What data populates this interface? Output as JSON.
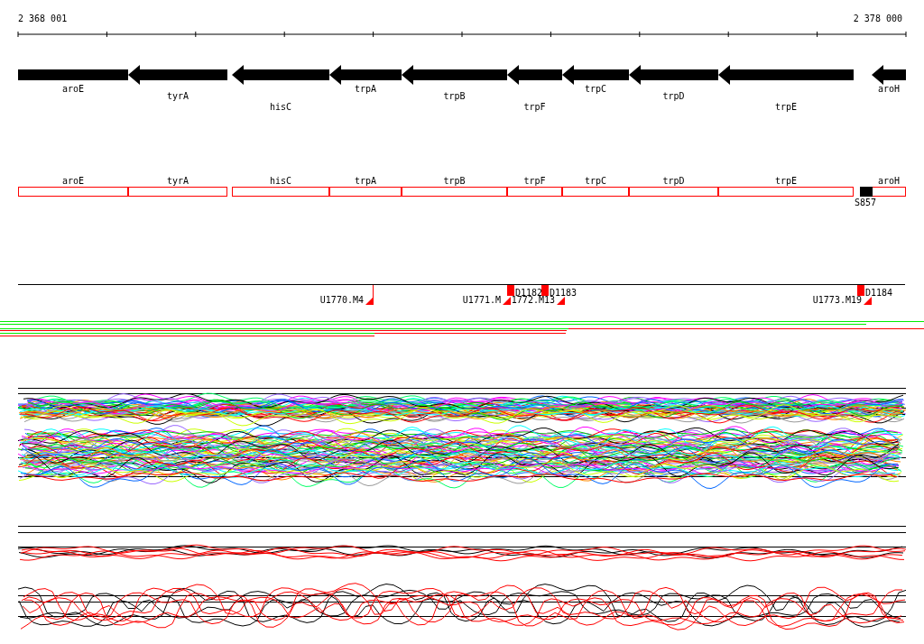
{
  "ruler": {
    "start": "2 368 001",
    "end": "2 378 000"
  },
  "genes": [
    {
      "name": "aroE",
      "kind": "block"
    },
    {
      "name": "tyrA",
      "kind": "reverse"
    },
    {
      "name": "hisC",
      "kind": "reverse"
    },
    {
      "name": "trpA",
      "kind": "reverse"
    },
    {
      "name": "trpB",
      "kind": "reverse"
    },
    {
      "name": "trpF",
      "kind": "reverse"
    },
    {
      "name": "trpC",
      "kind": "reverse"
    },
    {
      "name": "trpD",
      "kind": "reverse"
    },
    {
      "name": "trpE",
      "kind": "reverse"
    },
    {
      "name": "aroH",
      "kind": "reverse"
    }
  ],
  "gene_boxes": [
    {
      "name": "aroE"
    },
    {
      "name": "tyrA"
    },
    {
      "name": "hisC"
    },
    {
      "name": "trpA"
    },
    {
      "name": "trpB"
    },
    {
      "name": "trpF"
    },
    {
      "name": "trpC"
    },
    {
      "name": "trpD"
    },
    {
      "name": "trpE"
    },
    {
      "name": "aroH"
    }
  ],
  "feature": {
    "label": "S857"
  },
  "markers": [
    {
      "label": "U1770.M4",
      "kind": "u"
    },
    {
      "label": "U1771.M",
      "kind": "u"
    },
    {
      "label": "D1182",
      "kind": "d"
    },
    {
      "label": "1772.M13",
      "kind": "u"
    },
    {
      "label": "D1183",
      "kind": "d"
    },
    {
      "label": "U1773.M19",
      "kind": "u"
    },
    {
      "label": "D1184",
      "kind": "d"
    }
  ]
}
